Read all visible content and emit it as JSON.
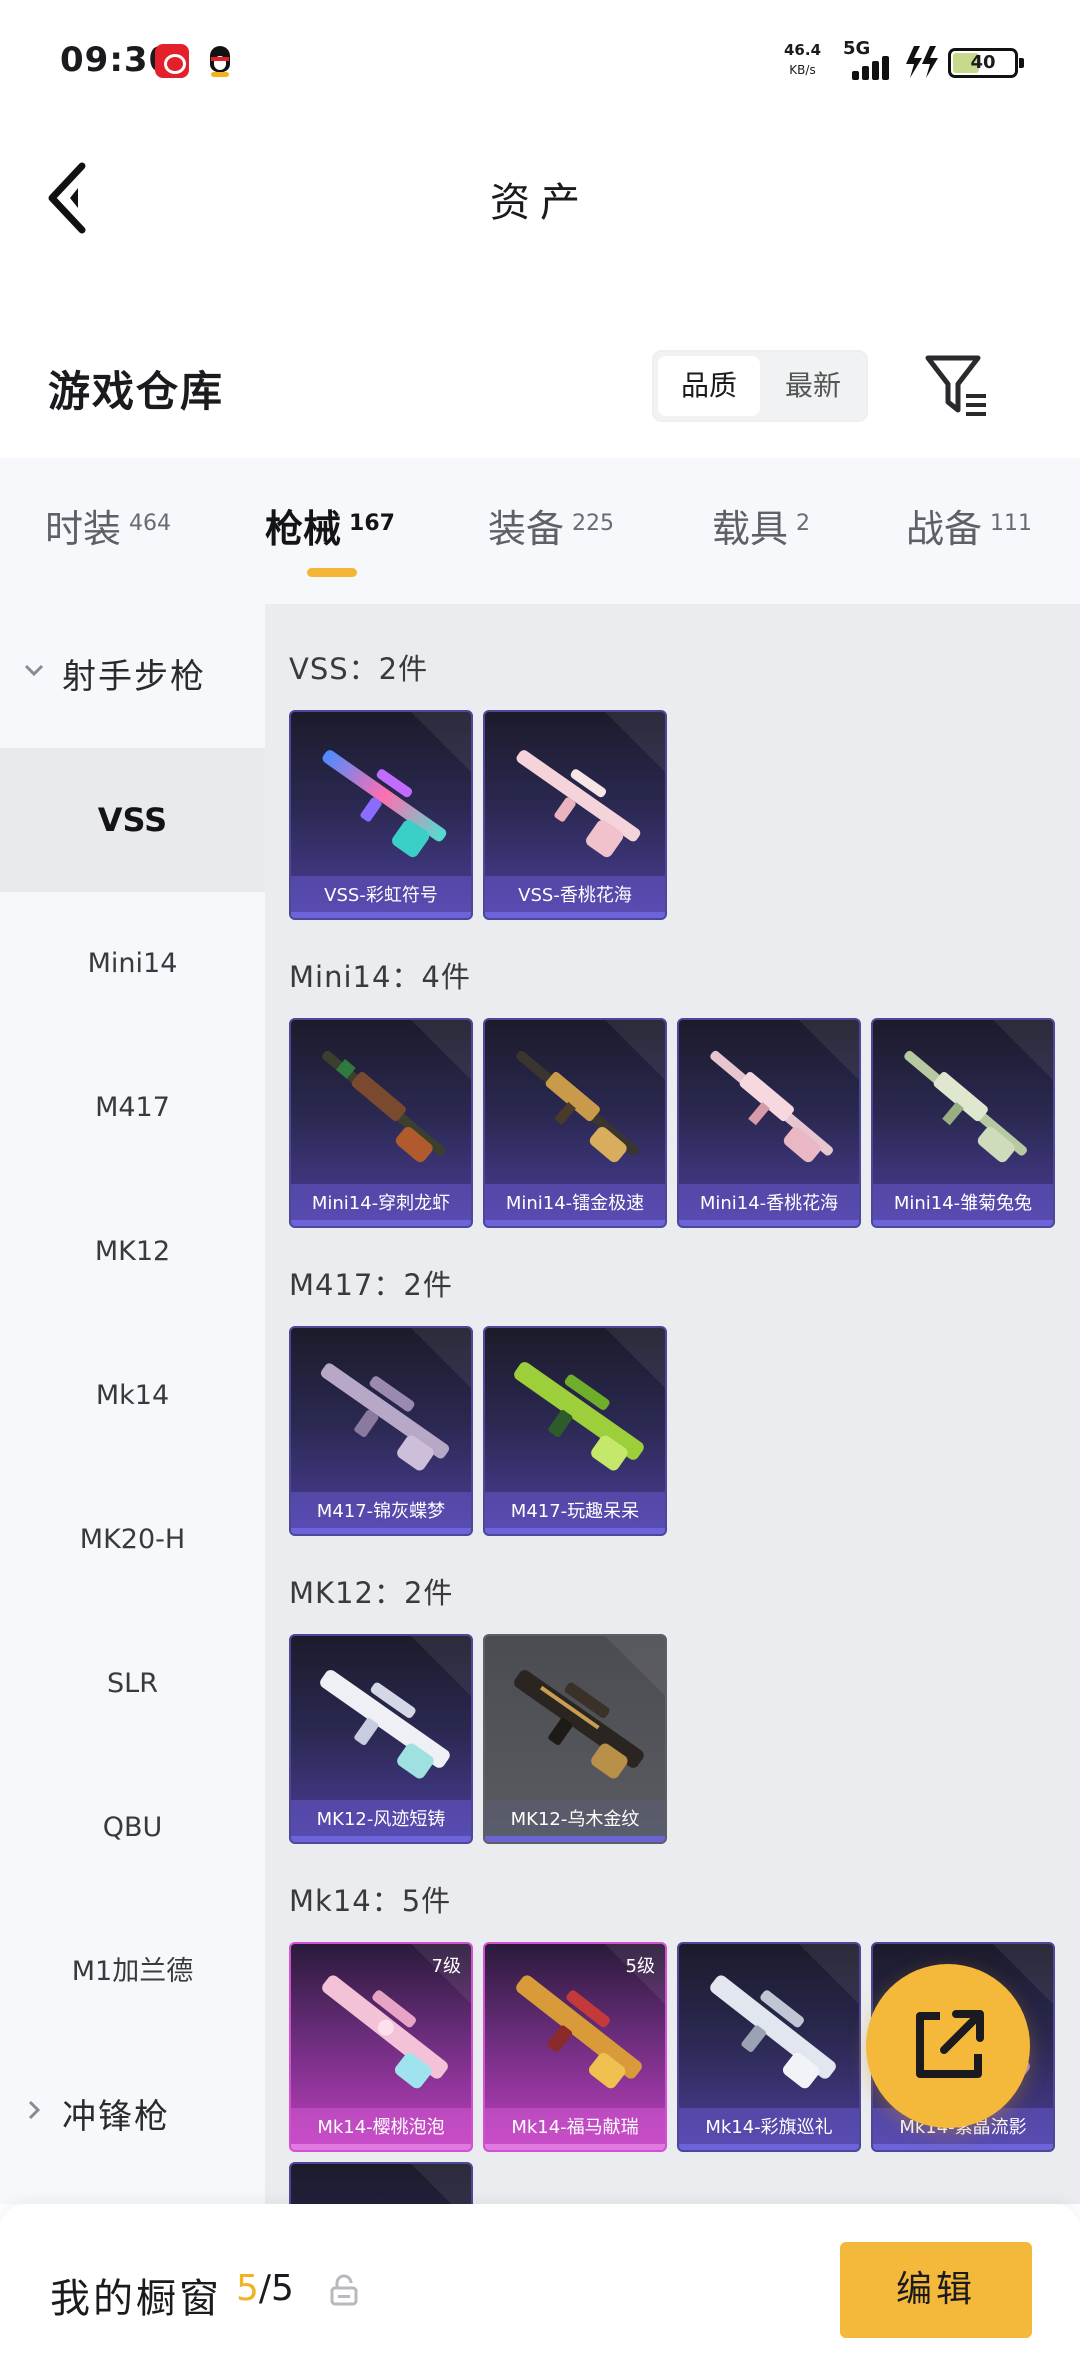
{
  "status_bar": {
    "time": "09:30",
    "net_speed": "46.4",
    "net_speed_unit": "KB/s",
    "network": "5G",
    "battery": "40",
    "battery_level": 0.4
  },
  "header": {
    "title": "资产",
    "back_icon": "chevron-left-icon"
  },
  "section": {
    "title": "游戏仓库",
    "sort_options": [
      "品质",
      "最新"
    ],
    "sort_selected": "品质",
    "filter_icon": "filter-icon"
  },
  "tabs": [
    {
      "label": "时装",
      "count": "464"
    },
    {
      "label": "枪械",
      "count": "167",
      "active": true
    },
    {
      "label": "装备",
      "count": "225"
    },
    {
      "label": "载具",
      "count": "2"
    },
    {
      "label": "战备",
      "count": "111"
    }
  ],
  "sidebar": {
    "group_expanded": "射手步枪",
    "items": [
      "VSS",
      "Mini14",
      "M417",
      "MK12",
      "Mk14",
      "MK20-H",
      "SLR",
      "QBU",
      "M1加兰德"
    ],
    "active_item": "VSS",
    "group_collapsed": "冲锋枪"
  },
  "groups": [
    {
      "title": "VSS：2件",
      "cards": [
        {
          "name": "VSS-彩虹符号"
        },
        {
          "name": "VSS-香桃花海"
        }
      ]
    },
    {
      "title": "Mini14：4件",
      "cards": [
        {
          "name": "Mini14-穿刺龙虾"
        },
        {
          "name": "Mini14-镭金极速"
        },
        {
          "name": "Mini14-香桃花海"
        },
        {
          "name": "Mini14-雏菊兔兔"
        }
      ]
    },
    {
      "title": "M417：2件",
      "cards": [
        {
          "name": "M417-锦灰蝶梦"
        },
        {
          "name": "M417-玩趣呆呆"
        }
      ]
    },
    {
      "title": "MK12：2件",
      "cards": [
        {
          "name": "MK12-风迹短铸"
        },
        {
          "name": "MK12-乌木金纹"
        }
      ]
    },
    {
      "title": "Mk14：5件",
      "cards": [
        {
          "name": "Mk14-樱桃泡泡",
          "level": "7级"
        },
        {
          "name": "Mk14-福马献瑞",
          "level": "5级"
        },
        {
          "name": "Mk14-彩旗巡礼"
        },
        {
          "name": "Mk14-紫晶流影"
        }
      ]
    }
  ],
  "share_icon": "share-icon",
  "bottom": {
    "label": "我的橱窗",
    "used": "5",
    "total": "/5",
    "lock_icon": "lock-icon",
    "edit_label": "编辑"
  }
}
